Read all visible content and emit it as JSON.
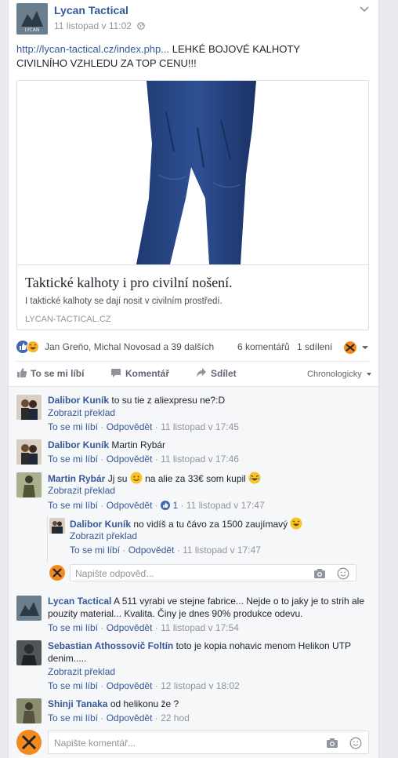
{
  "post": {
    "page_name": "Lycan Tactical",
    "timestamp": "11 listopad v 11:02",
    "audience_icon": "globe-icon",
    "link_text": "http://lycan-tactical.cz/index.php...",
    "body_text": " LEHKÉ BOJOVÉ KALHOTY CIVILNÍHO VZHLEDU ZA TOP CENU!!!",
    "menu_icon": "chevron-down-icon"
  },
  "link_preview": {
    "title": "Taktické kalhoty i pro civilní nošení.",
    "description": "I taktické kalhoty se dají nosit v civilním prostředí.",
    "domain": "LYCAN-TACTICAL.CZ"
  },
  "reactions": {
    "names": "Jan Greňo, Michal Novosad a 39 dalších",
    "comments_count": "6 komentářů",
    "shares_count": "1 sdílení"
  },
  "actions": {
    "like": "To se mi líbí",
    "comment": "Komentář",
    "share": "Sdílet",
    "sort": "Chronologicky"
  },
  "comments": [
    {
      "author": "Dalibor Kuník",
      "text": "to su tie z aliexpresu ne?:D",
      "translate": "Zobrazit překlad",
      "like": "To se mi líbí",
      "reply": "Odpovědět",
      "time": "11 listopad v 17:45"
    },
    {
      "author": "Dalibor Kuník",
      "text": "Martin Rybár",
      "like": "To se mi líbí",
      "reply": "Odpovědět",
      "time": "11 listopad v 17:46"
    },
    {
      "author": "Martin Rybár",
      "text1": "Jj su",
      "text2": "na alie za 33€ som kupil",
      "translate": "Zobrazit překlad",
      "like": "To se mi líbí",
      "reply": "Odpovědět",
      "likes": "1",
      "time": "11 listopad v 17:47"
    },
    {
      "author": "Lycan Tactical",
      "text": "A 511 vyrabi ve stejne fabrice... Nejde o to jaky je to strih ale pouzity material... Kvalita. Činy je dnes 90% produkce odevu.",
      "like": "To se mi líbí",
      "reply": "Odpovědět",
      "time": "11 listopad v 17:54"
    },
    {
      "author": "Sebastian Athossovič Foltín",
      "text": "toto je kopia nohavic menom Helikon UTP denim.....",
      "translate": "Zobrazit překlad",
      "like": "To se mi líbí",
      "reply": "Odpovědět",
      "time": "12 listopad v 18:02"
    },
    {
      "author": "Shinji Tanaka",
      "text": "od helikonu že ?",
      "like": "To se mi líbí",
      "reply": "Odpovědět",
      "time": "22 hod"
    }
  ],
  "reply": {
    "author": "Dalibor Kuník",
    "text": "no vidíš a tu čávo za 1500 zaujímavý",
    "translate": "Zobrazit překlad",
    "like": "To se mi líbí",
    "reply": "Odpovědět",
    "time": "11 listopad v 17:47",
    "input_placeholder": "Napište odpověď..."
  },
  "comment_input": {
    "placeholder": "Napište komentář..."
  },
  "colors": {
    "link": "#365899",
    "meta": "#90949c",
    "like_blue": "#4267b2",
    "haha_yellow": "#f7b125",
    "page_orange": "#f28a1c"
  }
}
